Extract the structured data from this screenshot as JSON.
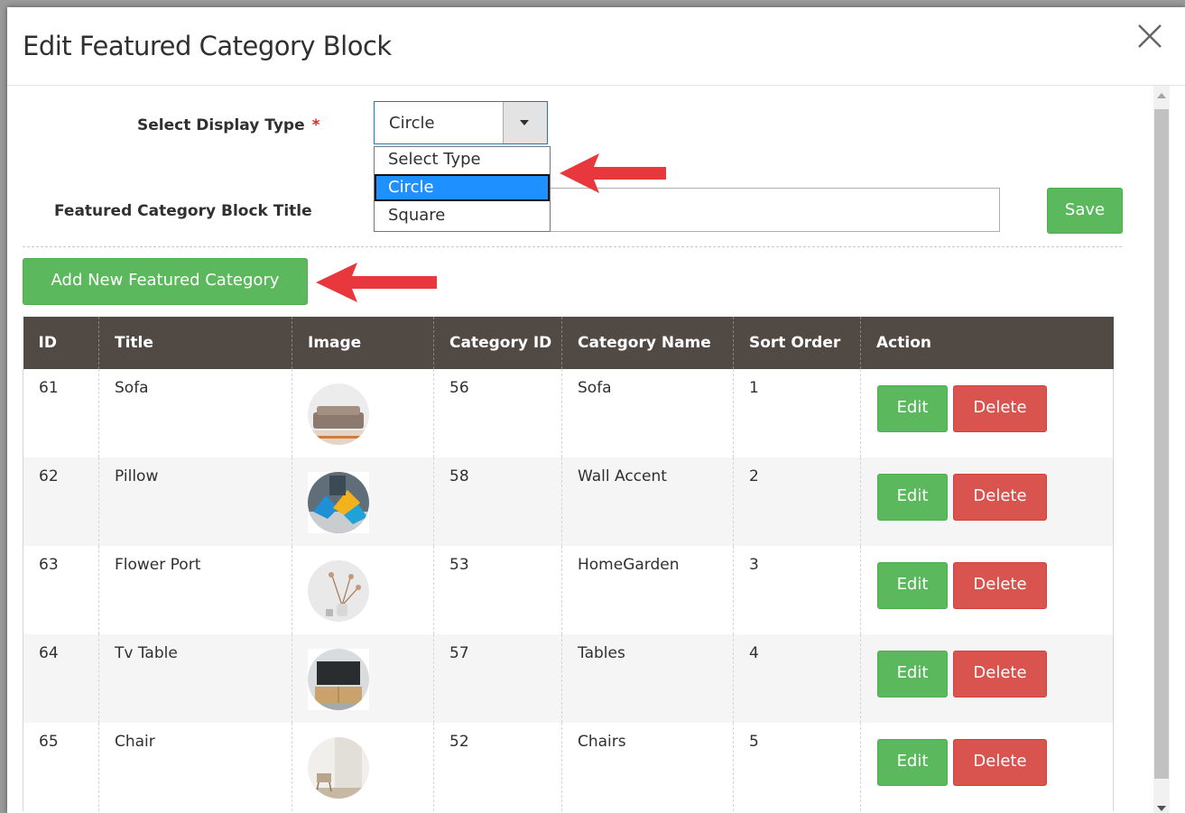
{
  "modal": {
    "title": "Edit Featured Category Block"
  },
  "form": {
    "display_type_label": "Select Display Type",
    "required_marker": "*",
    "display_type_value": "Circle",
    "display_type_options": [
      "Select Type",
      "Circle",
      "Square"
    ],
    "block_title_label": "Featured Category Block Title",
    "block_title_value": "",
    "save_label": "Save",
    "add_new_label": "Add New Featured Category"
  },
  "table": {
    "headers": [
      "ID",
      "Title",
      "Image",
      "Category ID",
      "Category Name",
      "Sort Order",
      "Action"
    ],
    "edit_label": "Edit",
    "delete_label": "Delete",
    "rows": [
      {
        "id": "61",
        "title": "Sofa",
        "image": "sofa-thumbnail",
        "category_id": "56",
        "category_name": "Sofa",
        "sort_order": "1"
      },
      {
        "id": "62",
        "title": "Pillow",
        "image": "pillow-thumbnail",
        "category_id": "58",
        "category_name": "Wall Accent",
        "sort_order": "2"
      },
      {
        "id": "63",
        "title": "Flower Port",
        "image": "flower-pot-thumbnail",
        "category_id": "53",
        "category_name": "HomeGarden",
        "sort_order": "3"
      },
      {
        "id": "64",
        "title": "Tv Table",
        "image": "tv-table-thumbnail",
        "category_id": "57",
        "category_name": "Tables",
        "sort_order": "4"
      },
      {
        "id": "65",
        "title": "Chair",
        "image": "chair-thumbnail",
        "category_id": "52",
        "category_name": "Chairs",
        "sort_order": "5"
      }
    ]
  },
  "colors": {
    "header_bg": "#514943",
    "button_green": "#5cb85c",
    "button_red": "#d9534f",
    "dropdown_highlight": "#1e90ff",
    "annotation_arrow": "#e8383d"
  }
}
